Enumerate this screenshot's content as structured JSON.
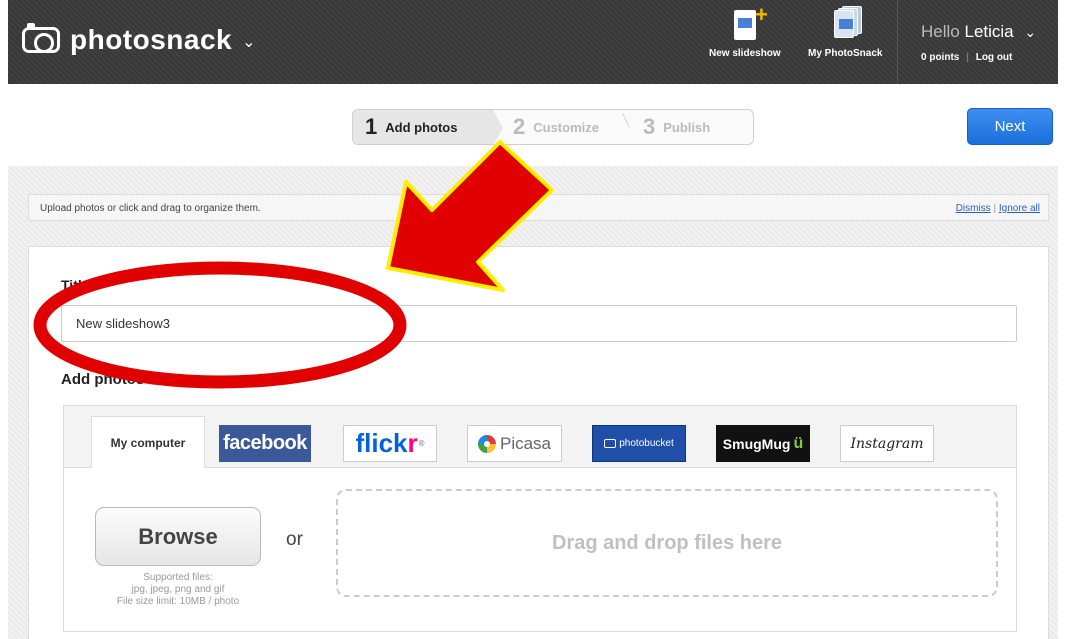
{
  "brand": {
    "name": "photosnack",
    "chevron": "⌄"
  },
  "topbar": {
    "new_slideshow": "New slideshow",
    "my_photosnack": "My PhotoSnack",
    "greeting": "Hello",
    "user_name": "Leticia",
    "points": "0 points",
    "logout": "Log out"
  },
  "steps": [
    {
      "num": "1",
      "label": "Add photos"
    },
    {
      "num": "2",
      "label": "Customize"
    },
    {
      "num": "3",
      "label": "Publish"
    }
  ],
  "next_label": "Next",
  "notice": {
    "message": "Upload photos or click and drag to organize them.",
    "dismiss": "Dismiss",
    "separator": "|",
    "ignore_all": "Ignore all"
  },
  "form": {
    "title_label": "Title",
    "title_value": "New slideshow3",
    "add_photos_label": "Add photos"
  },
  "sources": {
    "my_computer": "My computer",
    "facebook": "facebook",
    "flickr_a": "flick",
    "flickr_b": "r",
    "flickr_tm": "®",
    "picasa": "Picasa",
    "photobucket": "photobucket",
    "smugmug": "SmugMug",
    "instagram": "Instagram"
  },
  "upload": {
    "browse": "Browse",
    "supported_1": "Supported files:",
    "supported_2": "jpg, jpeg, png and gif",
    "supported_3": "File size limit: 10MB / photo",
    "or": "or",
    "drop": "Drag and drop files here"
  },
  "colors": {
    "topbar": "#3a3a3a",
    "accent": "#1a6fd8",
    "facebook": "#3b5998",
    "annotation": "#e00000",
    "annotation_outline": "#ffee00"
  }
}
